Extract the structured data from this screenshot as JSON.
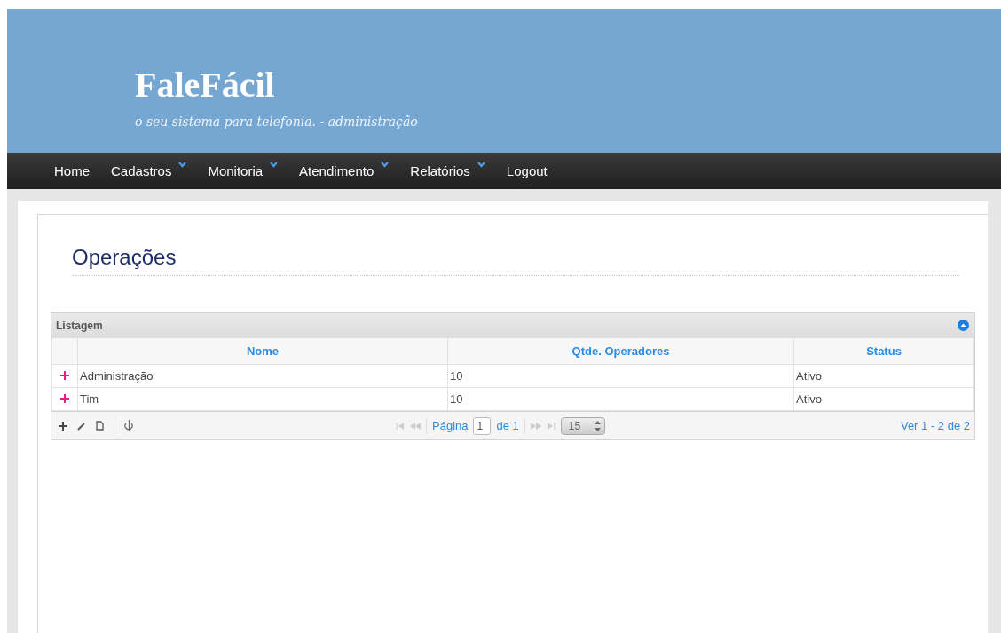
{
  "header": {
    "title": "FaleFácil",
    "subtitle": "o seu sistema para telefonia. - administração"
  },
  "nav": [
    {
      "label": "Home",
      "dropdown": false
    },
    {
      "label": "Cadastros",
      "dropdown": true
    },
    {
      "label": "Monitoria",
      "dropdown": true
    },
    {
      "label": "Atendimento",
      "dropdown": true
    },
    {
      "label": "Relatórios",
      "dropdown": true
    },
    {
      "label": "Logout",
      "dropdown": false
    }
  ],
  "page_title": "Operações",
  "grid": {
    "caption": "Listagem",
    "columns": [
      "Nome",
      "Qtde. Operadores",
      "Status"
    ],
    "rows": [
      [
        "Administração",
        "10",
        "Ativo"
      ],
      [
        "Tim",
        "10",
        "Ativo"
      ]
    ],
    "pager": {
      "page_label": "Página",
      "page": "1",
      "of_label": "de 1",
      "page_size": "15",
      "summary": "Ver 1 - 2 de 2"
    }
  }
}
